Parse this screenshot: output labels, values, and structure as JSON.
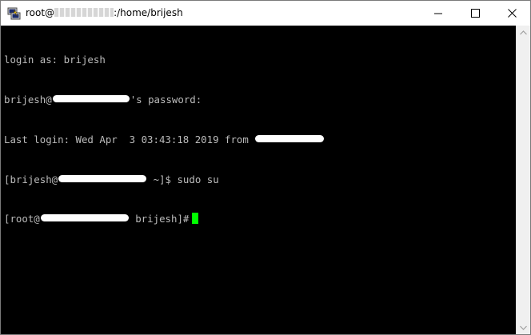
{
  "window": {
    "title_prefix": "root@",
    "title_suffix": ":/home/brijesh"
  },
  "terminal": {
    "line1": "login as: brijesh",
    "line2_user": "brijesh@",
    "line2_suffix": "'s password:",
    "line3": "Last login: Wed Apr  3 03:43:18 2019 from",
    "line4_prefix": "[brijesh@",
    "line4_suffix": " ~]$ sudo su",
    "line5_prefix": "[root@",
    "line5_suffix": " brijesh]#"
  },
  "colors": {
    "background": "#000000",
    "text": "#bbbbbb",
    "cursor": "#00ff00"
  },
  "icons": {
    "app": "putty-icon",
    "minimize": "minimize-icon",
    "maximize": "maximize-icon",
    "close": "close-icon"
  }
}
